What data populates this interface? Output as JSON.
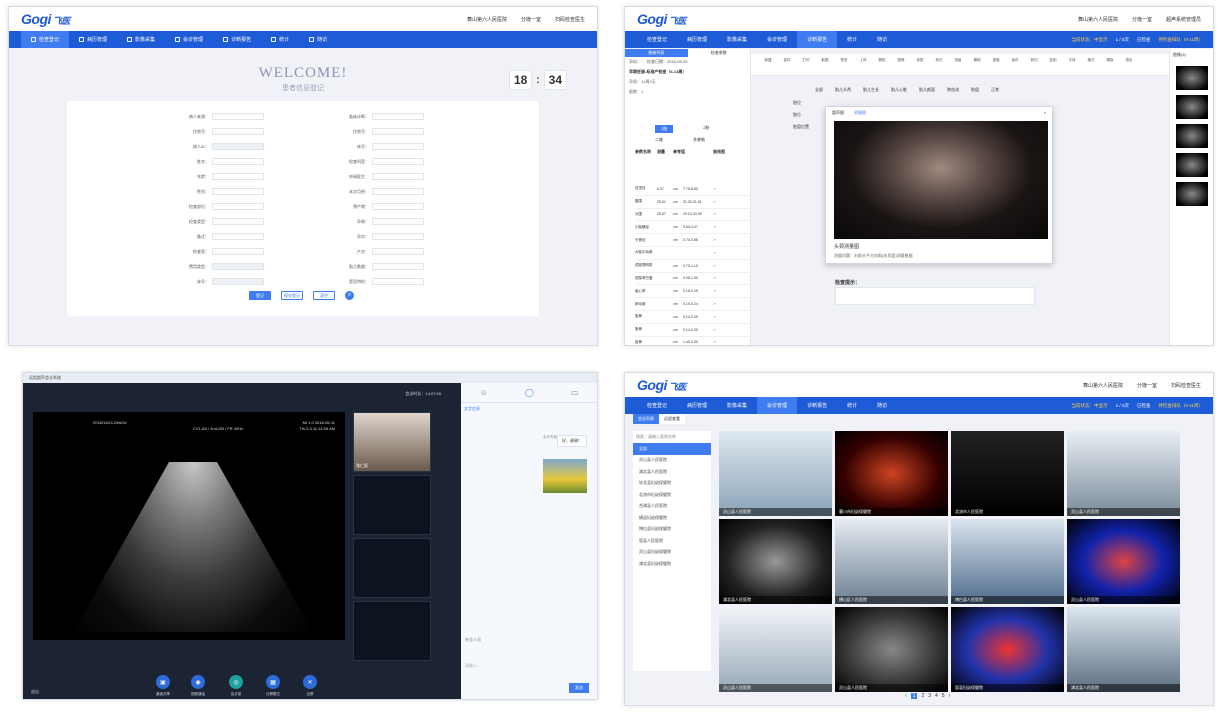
{
  "brand": {
    "logo": "Gogi",
    "logo_suffix": "飞医"
  },
  "top": {
    "hospital": "舞山第六人民医院",
    "dept": "分娩一室",
    "user": "扫码检查医生",
    "user2": "超声系统管理员"
  },
  "nav": [
    "检查登记",
    "病历管理",
    "影像采集",
    "会诊管理",
    "诊断报告",
    "统计",
    "随访"
  ],
  "nav_right": {
    "status": "当前状态：中显示",
    "queue": "1 / 0次",
    "done": "已检查",
    "pending": "待检查排队（0-11周）"
  },
  "p1": {
    "welcome": "WELCOME!",
    "subtitle": "患者信息登记",
    "clock_h": "18",
    "clock_m": "34",
    "left_fields": [
      "病人来源：",
      "住院号：",
      "病人ID：",
      "姓名：",
      "年龄：",
      "性别：",
      "检查部位：",
      "检查类型：",
      "备注：",
      "检查室：",
      "费用类型：",
      "床号："
    ],
    "right_fields": [
      "临床诊断：",
      "住院号：",
      "床号：",
      "检查科室：",
      "申请医生：",
      "末次月经：",
      "预产期：",
      "孕周：",
      "孕次：",
      "产次：",
      "胎儿数量：",
      "是否特检："
    ],
    "age_unit": "岁",
    "check_type": "产科B超",
    "days": "天",
    "gw": "周",
    "buttons": [
      "登记",
      "保存登记",
      "清空"
    ]
  },
  "p2": {
    "left_tabs": [
      "患者列表",
      "检查参数"
    ],
    "meta": [
      "孕妈：",
      "检查日期：2018-05-09",
      "孕周：13周2天",
      "胎数：1"
    ],
    "label_line": "早期妊娠-标准产检查（6-13周）",
    "tabs2": [
      "1胎",
      "2胎"
    ],
    "options": [
      "二维",
      "多普勒"
    ],
    "cols": [
      "参数名称",
      "测量",
      "参考值",
      "曲线图"
    ],
    "rows": [
      [
        "双顶径",
        "6.37",
        "cm",
        "7.75-8.83"
      ],
      [
        "腹围",
        "25.34",
        "cm",
        "31.33-31.51"
      ],
      [
        "头围",
        "25.67",
        "cm",
        "29.19-33.39"
      ],
      [
        "小脑横径",
        "",
        "cm",
        "3.53-4.47"
      ],
      [
        "头臀径",
        "",
        "cm",
        "0.74-0.85"
      ],
      [
        "大脑中动脉",
        "",
        "",
        ""
      ],
      [
        "颈部透明带",
        "",
        "cm",
        "0.70-1.10"
      ],
      [
        "颈部淋巴囊",
        "",
        "cm",
        "0.05-1.00"
      ],
      [
        "胎心率",
        "",
        "cm",
        "0.18-0.25"
      ],
      [
        "脐动脉",
        "",
        "cm",
        "0.19-0.24"
      ],
      [
        "肱骨",
        "",
        "cm",
        "0.14-0.35"
      ],
      [
        "股骨",
        "",
        "cm",
        "0.14-0.35"
      ],
      [
        "胫骨",
        "",
        "cm",
        "1.43-3.30"
      ]
    ],
    "dialog_tabs": [
      "超声图",
      "测量图"
    ],
    "dialog_caption": "头颈测量图",
    "dialog_sub": "测量问题：右前水平方向斜(矢状面)测量数据",
    "check_tip": "检查提示：",
    "right_title": "图像(4)",
    "toolbar": [
      "新建",
      "保存",
      "打印",
      "取图",
      "预览",
      "上传",
      "删除",
      "图像",
      "参数",
      "标记",
      "测量",
      "撤销",
      "重做",
      "保存",
      "剪切",
      "复制",
      "字体",
      "格式",
      "模板",
      "退出"
    ],
    "tabs_mid": [
      "全部",
      "胎儿头颅",
      "胎儿生长",
      "胎儿心脏",
      "胎儿颜面",
      "脐血流",
      "胎盘",
      "正常"
    ],
    "side_mid": [
      "胎位",
      "胎位",
      "胎盘位置"
    ]
  },
  "p3": {
    "title": "远程超声会诊系统",
    "time": "会诊时长：14:07:59",
    "us_info1": "2018/11/24,24wGd",
    "us_info2": "CV1-6A / 2nd-GB / FR 40Hz",
    "us_info3": "MI 1.0  2018-05-11",
    "us_info4": "TIs 0.3  11:14:05 AM",
    "chat_head": "文字信息",
    "msg1": "好，谢谢！",
    "msg_lbl1": "会诊专家",
    "chat_input": "请输入...",
    "send": "发送",
    "member": "参会人员",
    "controls": [
      "桌面共享",
      "视频通话",
      "会诊室",
      "分屏模式",
      "全屏"
    ],
    "exit": "退出",
    "doctor": "张仁医"
  },
  "p4": {
    "tabs": [
      "会诊列表",
      "远程查看"
    ],
    "search": "搜索：请输入医院名称",
    "list": [
      "全部",
      "灵山县人民医院",
      "浦北县人民医院",
      "钦北县妇幼保健院",
      "北流市妇幼保健院",
      "合浦县人民医院",
      "横县妇幼保健院",
      "博白县妇幼保健院",
      "容县人民医院",
      "灵山县妇幼保健院",
      "浦北县妇幼保健院"
    ],
    "captions": [
      "灵山县人民医院",
      "曹川市妇幼保健院",
      "北流市人民医院",
      "灵山县人民医院",
      "浦北县人民医院",
      "横山区人民医院",
      "博白县人民医院",
      "灵山县人民医院",
      "灵山县人民医院",
      "灵山县人民医院",
      "容县妇幼保健院",
      "浦北县人民医院"
    ],
    "pages": [
      "1",
      "2",
      "3",
      "4",
      "5"
    ]
  }
}
